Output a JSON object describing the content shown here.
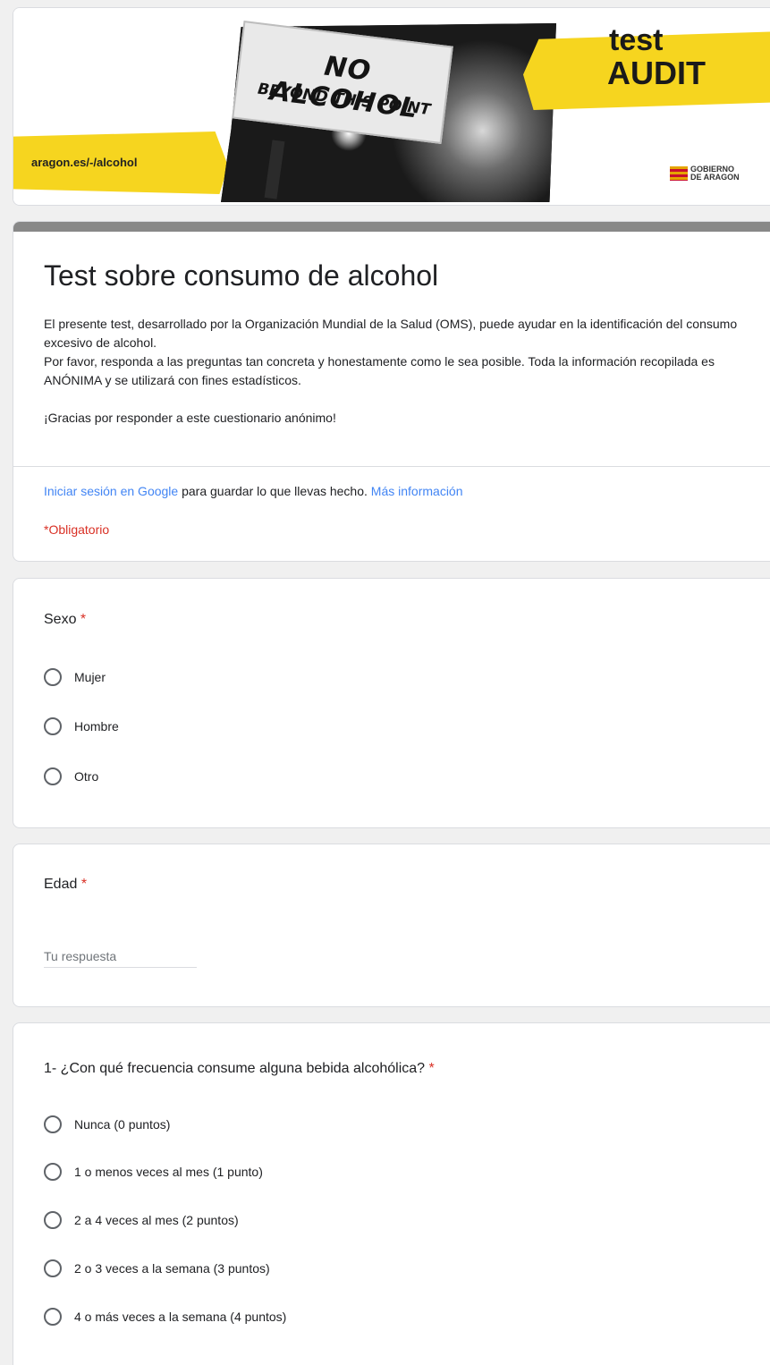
{
  "banner": {
    "url_text": "aragon.es/-/alcohol",
    "sign_line1": "NO ALCOHOL",
    "sign_line2": "BEYOND THIS POINT",
    "badge_line1": "test",
    "badge_line2": "AUDIT",
    "gov_line1": "GOBIERNO",
    "gov_line2": "DE ARAGON",
    "accent_color": "#f6d51f"
  },
  "form": {
    "title": "Test sobre consumo de alcohol",
    "description": [
      "El presente test, desarrollado por la Organización Mundial de la Salud (OMS), puede ayudar en la identificación del consumo excesivo de alcohol.",
      "Por favor, responda a las preguntas tan concreta y honestamente como le sea posible. Toda la información recopilada es ANÓNIMA y se utilizará con fines estadísticos.",
      "",
      "¡Gracias por responder a este cuestionario anónimo!"
    ],
    "signin_link": "Iniciar sesión en Google",
    "signin_text": " para guardar lo que llevas hecho. ",
    "more_info_link": "Más información",
    "required_note": "*Obligatorio",
    "header_strip_color": "#888888"
  },
  "questions": {
    "sexo": {
      "title": "Sexo",
      "required_mark": "*",
      "options": [
        "Mujer",
        "Hombre",
        "Otro"
      ]
    },
    "edad": {
      "title": "Edad",
      "required_mark": "*",
      "placeholder": "Tu respuesta"
    },
    "frecuencia": {
      "title": "1- ¿Con qué frecuencia consume alguna bebida alcohólica?",
      "required_mark": "*",
      "options": [
        "Nunca (0 puntos)",
        "1 o menos veces al mes (1 punto)",
        "2 a 4 veces al mes (2 puntos)",
        "2 o 3 veces a la semana (3 puntos)",
        "4 o más veces a la semana (4 puntos)"
      ]
    }
  }
}
